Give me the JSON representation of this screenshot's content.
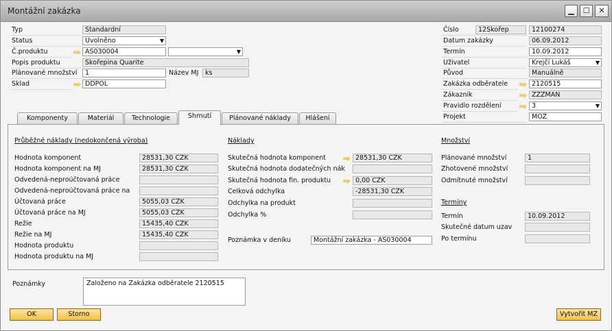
{
  "window": {
    "title": "Montážní zakázka"
  },
  "header_left": {
    "typ_label": "Typ",
    "typ_value": "Standardní",
    "status_label": "Status",
    "status_value": "Uvolněno",
    "cprod_label": "Č.produktu",
    "cprod_value": "AS030004",
    "cprod_extra": "",
    "popis_label": "Popis produktu",
    "popis_value": "Skořepina Quarite",
    "planmn_label": "Plánované množství",
    "planmn_value": "1",
    "mj_label": "Název MJ",
    "mj_value": "ks",
    "sklad_label": "Sklad",
    "sklad_value": "DDPOL"
  },
  "header_right": {
    "cislo_label": "Číslo",
    "cislo_series": "12Skořep",
    "cislo_value": "12100274",
    "datum_label": "Datum zakázky",
    "datum_value": "06.09.2012",
    "termin_label": "Termín",
    "termin_value": "10.09.2012",
    "uziv_label": "Uživatel",
    "uziv_value": "Krejčí Lukáš",
    "puvod_label": "Původ",
    "puvod_value": "Manuálně",
    "zakodb_label": "Zakázka odběratele",
    "zakodb_value": "2120515",
    "zakaznik_label": "Zákazník",
    "zakaznik_value": "ZZZMAN",
    "pravidlo_label": "Pravidlo rozdělení",
    "pravidlo_value": "3",
    "projekt_label": "Projekt",
    "projekt_value": "MOZ"
  },
  "tabs": [
    "Komponenty",
    "Materiál",
    "Technologie",
    "Shrnutí",
    "Plánované náklady",
    "Hlášení"
  ],
  "col1": {
    "title": "Průběžné náklady (nedokončená výroba)",
    "rows": [
      {
        "label": "Hodnota komponent",
        "value": "28531,30 CZK"
      },
      {
        "label": "Hodnota komponent na MJ",
        "value": "28531,30 CZK"
      },
      {
        "label": "Odvedená-neproúčtovaná práce",
        "value": ""
      },
      {
        "label": "Odvedená-neproúčtovaná práce na",
        "value": ""
      },
      {
        "label": "Účtovaná práce",
        "value": "5055,03 CZK"
      },
      {
        "label": "Účtovaná práce na MJ",
        "value": "5055,03 CZK"
      },
      {
        "label": "Režie",
        "value": "15435,40 CZK"
      },
      {
        "label": "Režie na MJ",
        "value": "15435,40 CZK"
      },
      {
        "label": "Hodnota produktu",
        "value": ""
      },
      {
        "label": "Hodnota produktu na MJ",
        "value": ""
      }
    ]
  },
  "col2": {
    "title": "Náklady",
    "rows": [
      {
        "label": "Skutečná hodnota komponent",
        "value": "28531,30 CZK"
      },
      {
        "label": "Skutečná hodnota dodatečných nák",
        "value": ""
      },
      {
        "label": "Skutečná hodnota fin. produktu",
        "value": "0,00 CZK"
      },
      {
        "label": "Celková odchylka",
        "value": "-28531,30 CZK"
      },
      {
        "label": "Odchylka na produkt",
        "value": ""
      },
      {
        "label": "Odchylka %",
        "value": ""
      }
    ],
    "note_label": "Poznámka v deníku",
    "note_value": "Montážní zakázka - AS030004"
  },
  "col3": {
    "title": "Množství",
    "rows": [
      {
        "label": "Plánované množství",
        "value": "1"
      },
      {
        "label": "Zhotovené množství",
        "value": ""
      },
      {
        "label": "Odmítnuté množství",
        "value": ""
      }
    ],
    "title2": "Termíny",
    "rows2": [
      {
        "label": "Termín",
        "value": "10.09.2012"
      },
      {
        "label": "Skutečné datum uzav",
        "value": ""
      },
      {
        "label": "Po termínu",
        "value": ""
      }
    ]
  },
  "remarks": {
    "label": "Poznámky",
    "value": "Založeno na Zakázka odběratele 2120515"
  },
  "buttons": {
    "ok": "OK",
    "cancel": "Storno",
    "create": "Vytvořit MZ"
  }
}
